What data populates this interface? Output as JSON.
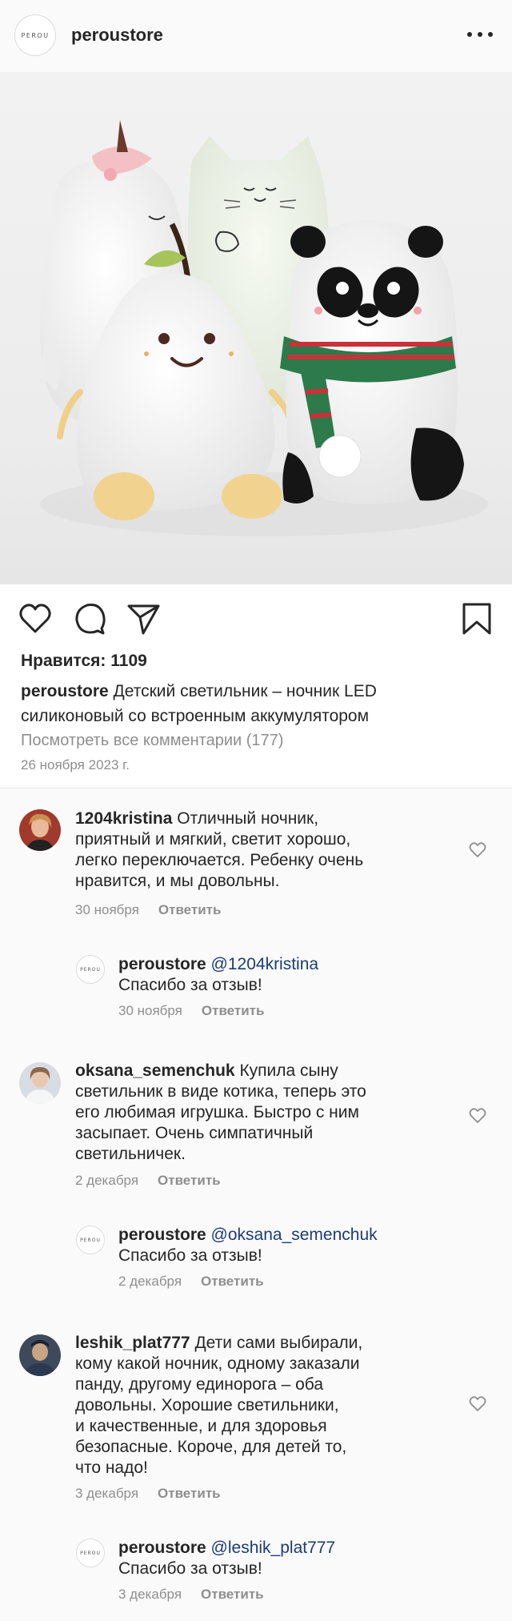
{
  "header": {
    "logo_text": "PEROU",
    "username": "peroustore",
    "more_icon": "more-horizontal-icon"
  },
  "post": {
    "image_alt": "Детский светильник – ночник LED силиконовый",
    "likes_label": "Нравится: 1109",
    "caption_username": "peroustore",
    "caption_line1": "Детский светильник – ночник LED",
    "caption_line2": "силиконовый со встроенным аккумулятором",
    "view_all": "Посмотреть все комментарии (177)",
    "date": "26 ноября 2023 г."
  },
  "actions": {
    "like_icon": "heart-icon",
    "comment_icon": "comment-icon",
    "share_icon": "send-icon",
    "save_icon": "bookmark-icon"
  },
  "reply_label": "Ответить",
  "comments": [
    {
      "username": "1204kristina",
      "lines": [
        "Отличный ночник,",
        "приятный и мягкий, светит хорошо,",
        "легко переключается. Ребенку очень",
        "нравится, и мы довольны."
      ],
      "date": "30 ноября",
      "reply": {
        "username": "peroustore",
        "mention": "@1204kristina",
        "text": "Спасибо за отзыв!",
        "date": "30 ноября"
      }
    },
    {
      "username": "oksana_semenchuk",
      "lines": [
        "Купила сыну",
        "светильник в виде котика, теперь это",
        "его любимая игрушка. Быстро с ним",
        "засыпает. Очень симпатичный",
        "светильничек."
      ],
      "date": "2 декабря",
      "reply": {
        "username": "peroustore",
        "mention": "@oksana_semenchuk",
        "text": "Спасибо за отзыв!",
        "date": "2 декабря"
      }
    },
    {
      "username": "leshik_plat777",
      "lines": [
        "Дети сами выбирали,",
        "кому какой ночник, одному заказали",
        "панду, другому единорога – оба",
        "довольны. Хорошие светильники,",
        "и качественные, и для здоровья",
        "безопасные. Короче, для детей то,",
        "что надо!"
      ],
      "date": "3 декабря",
      "reply": {
        "username": "peroustore",
        "mention": "@leshik_plat777",
        "text": "Спасибо за отзыв!",
        "date": "3 декабря"
      }
    }
  ]
}
